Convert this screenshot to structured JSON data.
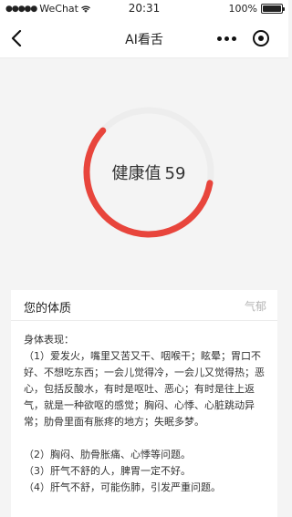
{
  "status_bar": {
    "carrier": "WeChat",
    "time": "20:31",
    "battery": "100%"
  },
  "nav": {
    "title": "AI看舌"
  },
  "gauge": {
    "label": "健康值",
    "value": "59",
    "progress": 0.59,
    "colors": {
      "active": "#e8453c",
      "track": "#ededed"
    }
  },
  "card": {
    "title": "您的体质",
    "tag": "气郁",
    "heading": "身体表现：",
    "paragraph1": "（1）爱发火，嘴里又苦又干、咽喉干；眩晕；胃口不好、不想吃东西；一会儿觉得冷，一会儿又觉得热；恶心，包括反酸水，有时是呕吐、恶心；有时是往上返气，就是一种欲呕的感觉；胸闷、心悸、心脏跳动异常；肋骨里面有胀疼的地方；失眠多梦。",
    "item2": "（2）胸闷、肋骨胀痛、心悸等问题。",
    "item3": "（3）肝气不舒的人，脾胃一定不好。",
    "item4": "（4）肝气不舒，可能伤肺，引发严重问题。"
  }
}
